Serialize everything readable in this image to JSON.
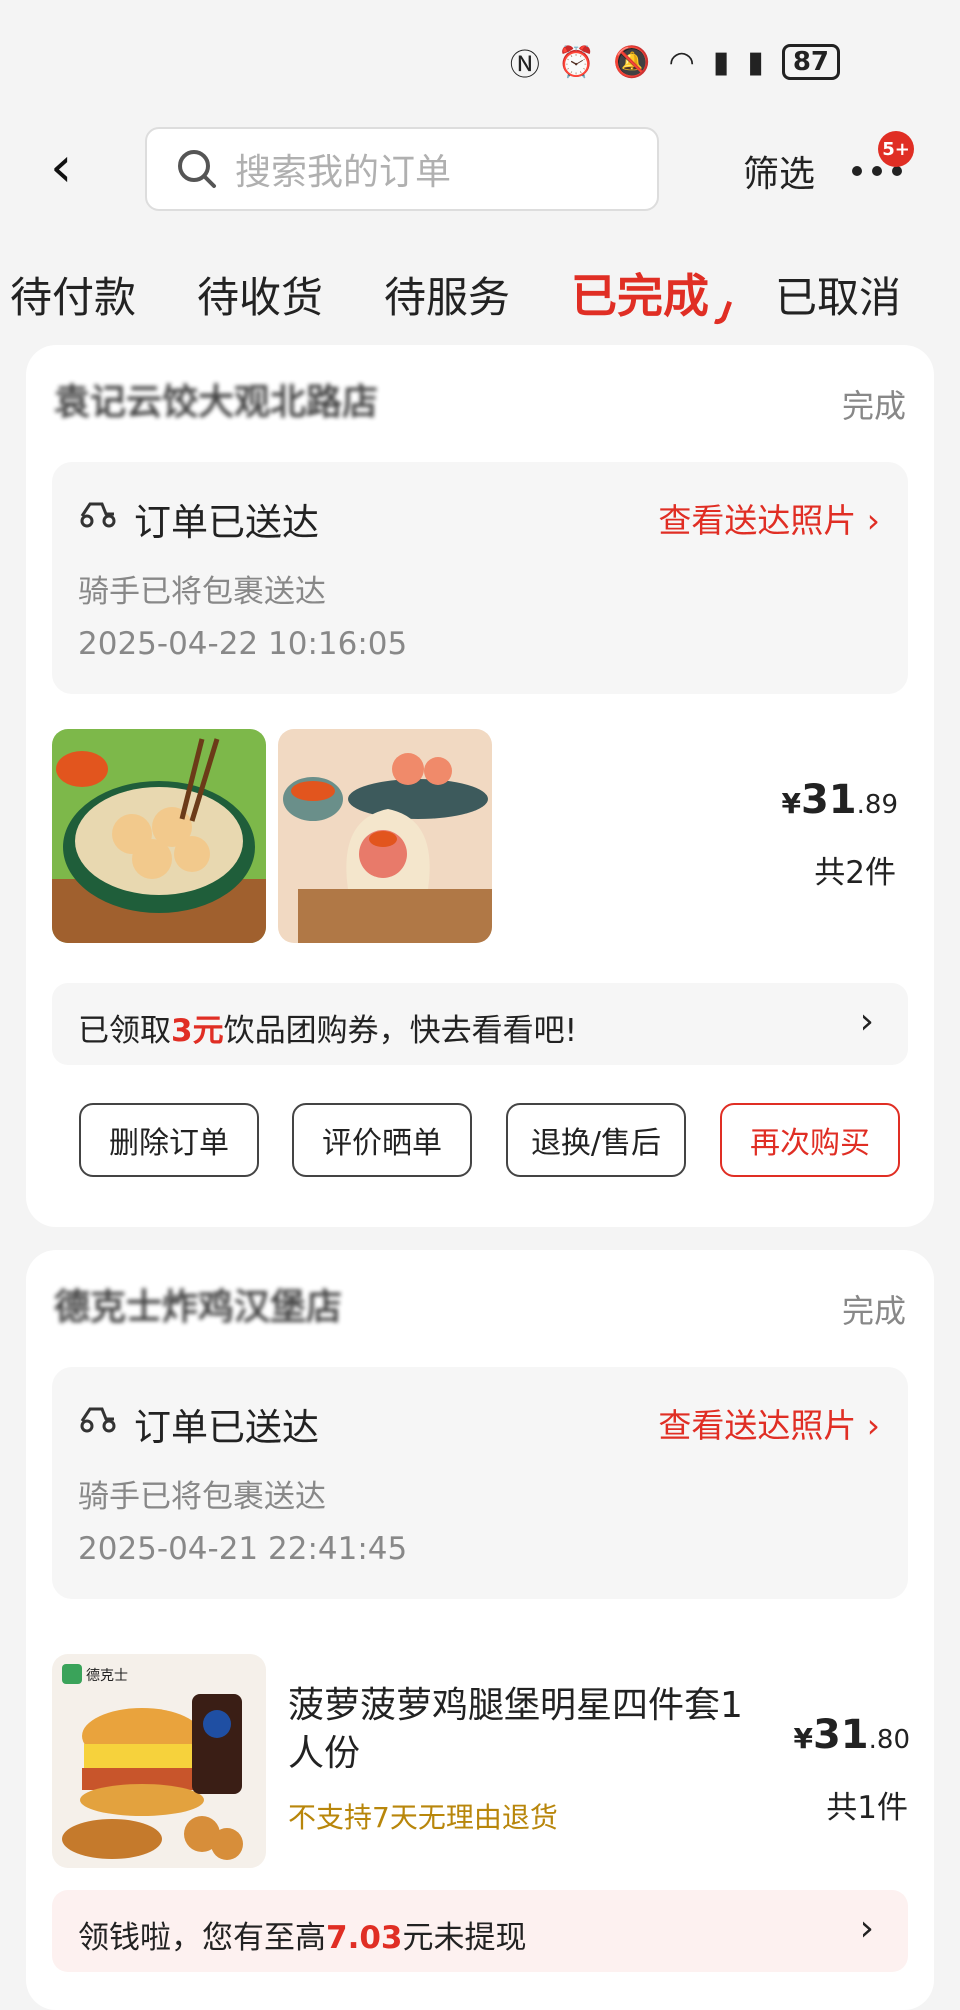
{
  "statusbar": {
    "battery": "87"
  },
  "topbar": {
    "back_icon": "chevron-left-icon",
    "search_placeholder": "搜索我的订单",
    "filter_label": "筛选",
    "more_badge": "5+"
  },
  "tabs": [
    {
      "label": "待付款"
    },
    {
      "label": "待收货"
    },
    {
      "label": "待服务"
    },
    {
      "label": "已完成"
    },
    {
      "label": "已取消"
    }
  ],
  "orders": [
    {
      "shop_name": "袁记云饺大观北路店",
      "status": "完成",
      "delivery_title": "订单已送达",
      "delivery_link": "查看送达照片",
      "delivery_sub": "骑手已将包裹送达",
      "delivery_time": "2025-04-22 10:16:05",
      "price_currency": "¥",
      "price_int": "31",
      "price_cents": ".89",
      "count": "共2件",
      "notice_prefix": "已领取",
      "notice_highlight": "3元",
      "notice_suffix": "饮品团购券，快去看看吧!",
      "buttons": [
        "删除订单",
        "评价晒单",
        "退换/售后",
        "再次购买"
      ]
    },
    {
      "shop_name": "德克士炸鸡汉堡店",
      "status": "完成",
      "delivery_title": "订单已送达",
      "delivery_link": "查看送达照片",
      "delivery_sub": "骑手已将包裹送达",
      "delivery_time": "2025-04-21 22:41:45",
      "product_title": "菠萝菠萝鸡腿堡明星四件套1人份",
      "product_warning": "不支持7天无理由退货",
      "brand_logo": "德克士",
      "price_currency": "¥",
      "price_int": "31",
      "price_cents": ".80",
      "count": "共1件",
      "notice_prefix": "领钱啦，您有至高",
      "notice_highlight": "7.03",
      "notice_suffix": "元未提现"
    }
  ],
  "colors": {
    "accent": "#e02e24",
    "warning": "#b8860b"
  }
}
